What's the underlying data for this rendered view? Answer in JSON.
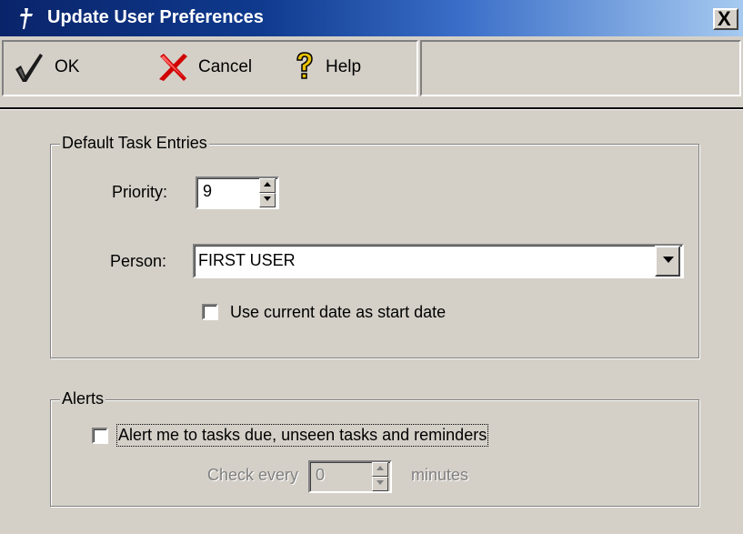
{
  "window": {
    "title": "Update User Preferences",
    "close_label": "X"
  },
  "toolbar": {
    "ok_label": "OK",
    "cancel_label": "Cancel",
    "help_label": "Help"
  },
  "defaults_group": {
    "title": "Default Task Entries",
    "priority_label": "Priority:",
    "priority_value": "9",
    "person_label": "Person:",
    "person_value": "FIRST USER",
    "use_current_date_label": "Use current date as start date",
    "use_current_date_checked": false
  },
  "alerts_group": {
    "title": "Alerts",
    "alert_label": "Alert me to tasks due, unseen tasks and reminders",
    "alert_checked": false,
    "check_every_label": "Check every",
    "check_every_value": "0",
    "minutes_label": "minutes"
  },
  "colors": {
    "title_bar_start": "#0a246a",
    "title_bar_end": "#a6caf0",
    "dialog_face": "#d4d0c8",
    "ok_check": "#1a1a1a",
    "cancel_x": "#d00000",
    "help_question": "#e8c000"
  },
  "icons": {
    "title": "dagger-icon",
    "ok": "checkmark-icon",
    "cancel": "red-x-icon",
    "help": "question-mark-icon"
  }
}
